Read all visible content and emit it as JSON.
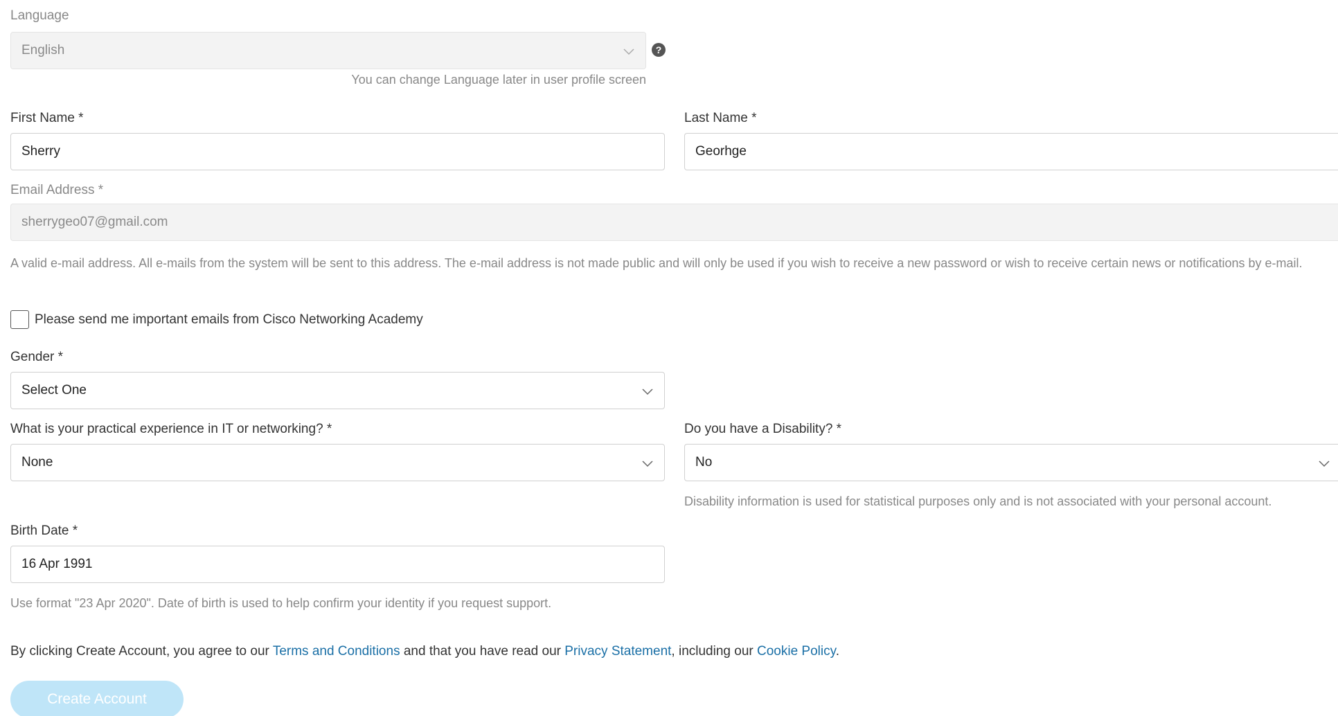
{
  "language": {
    "label": "Language",
    "value": "English",
    "hint": "You can change Language later in user profile screen"
  },
  "first_name": {
    "label": "First Name *",
    "value": "Sherry"
  },
  "last_name": {
    "label": "Last Name *",
    "value": "Georhge"
  },
  "email": {
    "label": "Email Address *",
    "value": "sherrygeo07@gmail.com",
    "description": "A valid e-mail address. All e-mails from the system will be sent to this address. The e-mail address is not made public and will only be used if you wish to receive a new password or wish to receive certain news or notifications by e-mail."
  },
  "newsletter": {
    "label": "Please send me important emails from Cisco Networking Academy",
    "checked": false
  },
  "gender": {
    "label": "Gender *",
    "value": "Select One"
  },
  "experience": {
    "label": "What is your practical experience in IT or networking? *",
    "value": "None"
  },
  "disability": {
    "label": "Do you have a Disability? *",
    "value": "No",
    "hint": "Disability information is used for statistical purposes only and is not associated with your personal account."
  },
  "birth_date": {
    "label": "Birth Date *",
    "value": "16 Apr 1991",
    "hint": "Use format \"23 Apr 2020\". Date of birth is used to help confirm your identity if you request support."
  },
  "agreement": {
    "prefix": "By clicking Create Account, you agree to our ",
    "terms_link": "Terms and Conditions",
    "middle": " and that you have read our ",
    "privacy_link": "Privacy Statement",
    "comma": ", including our ",
    "cookie_link": "Cookie Policy",
    "suffix": "."
  },
  "submit": {
    "label": "Create Account"
  },
  "icons": {
    "help": "question-circle-icon",
    "dropdown": "chevron-down-icon"
  },
  "colors": {
    "link": "#1a6fa6",
    "button_disabled": "#bfe5f8"
  }
}
